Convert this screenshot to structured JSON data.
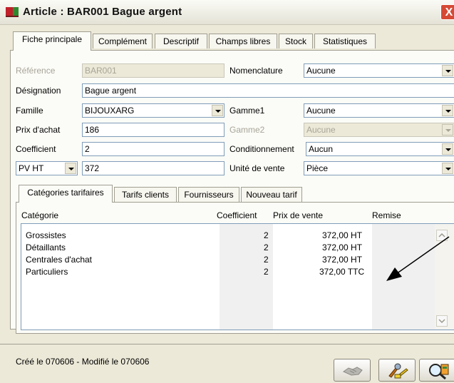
{
  "window": {
    "title": "Article : BAR001 Bague argent",
    "close_symbol": "X",
    "title_icon": "article-book-icon"
  },
  "tabs": [
    {
      "label": "Fiche principale",
      "active": true
    },
    {
      "label": "Complément",
      "active": false
    },
    {
      "label": "Descriptif",
      "active": false
    },
    {
      "label": "Champs libres",
      "active": false
    },
    {
      "label": "Stock",
      "active": false
    },
    {
      "label": "Statistiques",
      "active": false
    }
  ],
  "form": {
    "reference": {
      "label": "Référence",
      "value": "BAR001"
    },
    "nomenclature": {
      "label": "Nomenclature",
      "value": "Aucune"
    },
    "designation": {
      "label": "Désignation",
      "value": "Bague argent"
    },
    "famille": {
      "label": "Famille",
      "value": "BIJOUXARG"
    },
    "gamme1": {
      "label": "Gamme1",
      "value": "Aucune"
    },
    "prix_achat": {
      "label": "Prix d'achat",
      "value": "186"
    },
    "gamme2": {
      "label": "Gamme2",
      "value": "Aucune"
    },
    "coefficient": {
      "label": "Coefficient",
      "value": "2"
    },
    "conditionnement": {
      "label": "Conditionnement",
      "value": "Aucun"
    },
    "pv_mode": {
      "value": "PV HT"
    },
    "pv_value": {
      "value": "372"
    },
    "unite_vente": {
      "label": "Unité de vente",
      "value": "Pièce"
    }
  },
  "subtabs": [
    {
      "label": "Catégories tarifaires",
      "active": true
    },
    {
      "label": "Tarifs clients",
      "active": false
    },
    {
      "label": "Fournisseurs",
      "active": false
    },
    {
      "label": "Nouveau tarif",
      "active": false
    }
  ],
  "table": {
    "headers": {
      "categorie": "Catégorie",
      "coefficient": "Coefficient",
      "prix": "Prix de vente",
      "remise": "Remise"
    },
    "rows": [
      {
        "categorie": "Grossistes",
        "coefficient": "2",
        "prix": "372,00 HT",
        "remise": ""
      },
      {
        "categorie": "Détaillants",
        "coefficient": "2",
        "prix": "372,00 HT",
        "remise": ""
      },
      {
        "categorie": "Centrales d'achat",
        "coefficient": "2",
        "prix": "372,00 HT",
        "remise": ""
      },
      {
        "categorie": "Particuliers",
        "coefficient": "2",
        "prix": "372,00 TTC",
        "remise": ""
      }
    ]
  },
  "status": {
    "text": "Créé le 070606 - Modifié le 070606"
  },
  "toolbar": {
    "buttons": [
      {
        "icon": "handshake-icon",
        "enabled": false
      },
      {
        "icon": "tools-icon",
        "enabled": true
      },
      {
        "icon": "search-icon",
        "enabled": true
      }
    ]
  },
  "colors": {
    "window_bg": "#ece9d8",
    "panel_bg": "#fbfbf7",
    "field_border": "#7f9db9",
    "close_button": "#d64a35"
  }
}
